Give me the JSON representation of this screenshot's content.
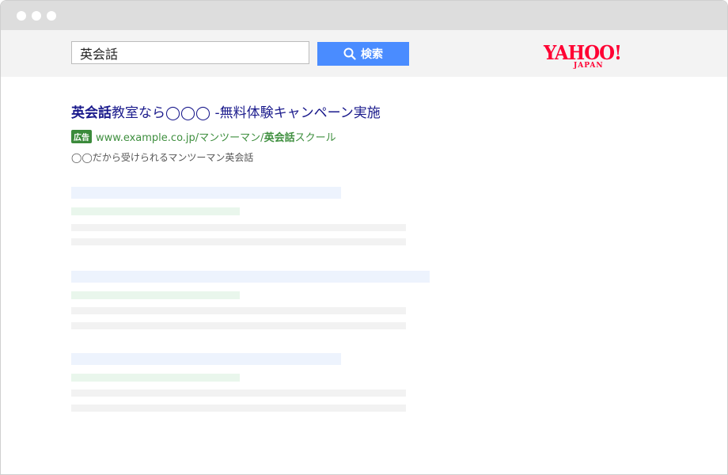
{
  "search": {
    "query": "英会話",
    "button_label": "検索"
  },
  "logo": {
    "main": "YAHOO!",
    "sub": "JAPAN"
  },
  "result": {
    "title_keyword": "英会話",
    "title_rest": "教室なら◯◯◯ -無料体験キャンペーン実施",
    "ad_badge": "広告",
    "url_prefix": "www.example.co.jp/マンツーマン/",
    "url_keyword": "英会話",
    "url_suffix": "スクール",
    "description": "◯◯だから受けられるマンツーマン英会話"
  },
  "colors": {
    "search_button": "#4a8cff",
    "logo": "#ff0033",
    "title_link": "#1a1a8c",
    "url_green": "#3f8f3f",
    "ad_badge": "#3b8a3b"
  }
}
